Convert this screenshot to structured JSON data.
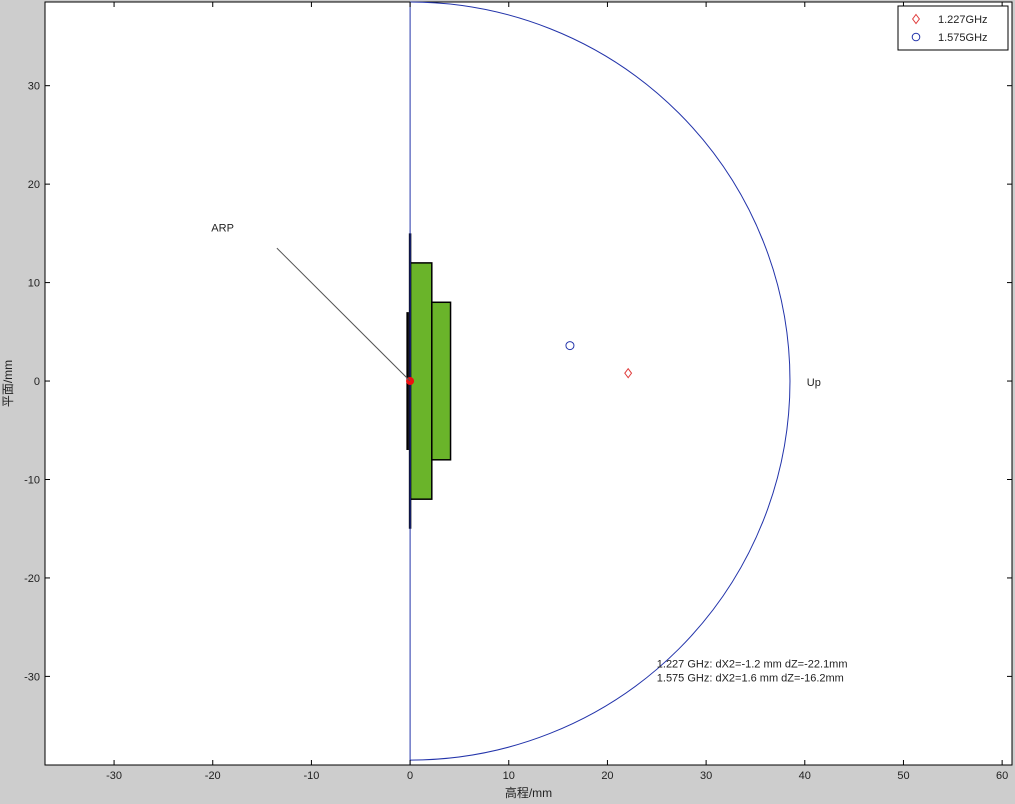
{
  "chart_data": {
    "type": "scatter",
    "title": "",
    "xlabel": "高程/mm",
    "ylabel": "平面/mm",
    "xlim": [
      -37,
      61
    ],
    "ylim": [
      -39,
      38.5
    ],
    "xticks": [
      -30,
      -20,
      -10,
      0,
      10,
      20,
      30,
      40,
      50,
      60
    ],
    "yticks": [
      -30,
      -20,
      -10,
      0,
      10,
      20,
      30
    ],
    "xtick_labels": [
      "-30",
      "-20",
      "-10",
      "0",
      "10",
      "20",
      "30",
      "40",
      "50",
      "60"
    ],
    "ytick_labels": [
      "-30",
      "-20",
      "-10",
      "0",
      "10",
      "20",
      "30"
    ],
    "grid": false,
    "legend": {
      "position": "top-right",
      "entries": [
        {
          "label": "1.227GHz",
          "marker": "diamond",
          "color": "#e03c3c"
        },
        {
          "label": "1.575GHz",
          "marker": "circle",
          "color": "#2233aa"
        }
      ]
    },
    "series": [
      {
        "name": "1.227GHz",
        "marker": "diamond",
        "color": "#e03c3c",
        "points": [
          {
            "x": 22.1,
            "y": 0.8
          }
        ]
      },
      {
        "name": "1.575GHz",
        "marker": "circle",
        "color": "#2233aa",
        "points": [
          {
            "x": 16.2,
            "y": 3.6
          }
        ]
      }
    ],
    "half_circle": {
      "center_x": 0,
      "center_y": 0,
      "radius": 38.5,
      "color": "#2233aa"
    },
    "axis_line": {
      "x": 0,
      "color": "#2233aa"
    },
    "antenna_blocks": [
      {
        "x0": 0,
        "x1": 2.2,
        "y0": -12,
        "y1": 12,
        "color": "#6ab42a"
      },
      {
        "x0": 2.2,
        "x1": 4.1,
        "y0": -8,
        "y1": 8,
        "color": "#6ab42a"
      }
    ],
    "antenna_bars": [
      {
        "x": 0,
        "y0": -15,
        "y1": 15
      },
      {
        "x": -0.25,
        "y0": -7,
        "y1": 7
      }
    ],
    "arp": {
      "label": "ARP",
      "x": 0,
      "y": 0,
      "color": "#ee1111",
      "leader_start": {
        "x": -13.5,
        "y": 13.5
      },
      "label_pos": {
        "x": -19,
        "y": 15.2
      }
    },
    "annotations": [
      {
        "text": "Up",
        "x": 40.2,
        "y": -0.1
      },
      {
        "text": "1.227 GHz: dX2=-1.2 mm dZ=-22.1mm",
        "x": 25,
        "y": -28.7
      },
      {
        "text": "1.575 GHz: dX2=1.6 mm dZ=-16.2mm",
        "x": 25,
        "y": -30.1
      }
    ]
  }
}
